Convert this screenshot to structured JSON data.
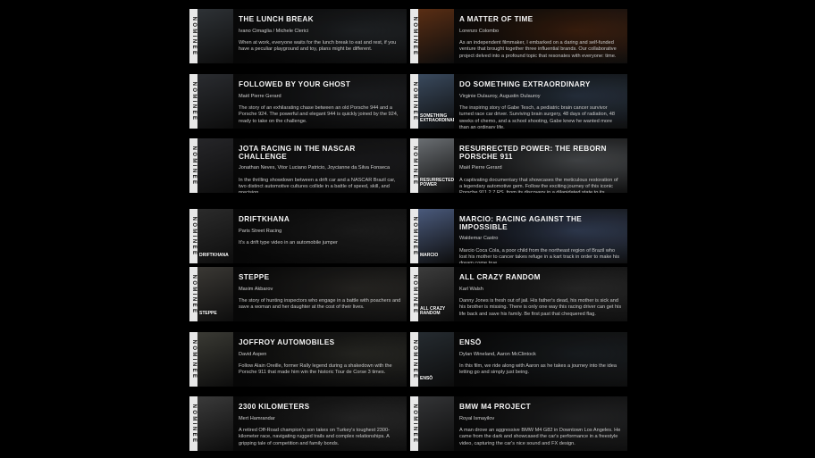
{
  "nominee_label": "NOMINEE",
  "colors": {
    "page_bg": "#000000",
    "nominee_strip": "#e8e8e8",
    "title": "#f4f4f4",
    "text": "#c8c8c8"
  },
  "films": [
    {
      "title": "THE LUNCH BREAK",
      "credits": "Ivano Cimaglia / Michele Clerici",
      "description": "When at work, everyone waits for the lunch break to eat and rest, if you have a peculiar playground and toy, plans might be different.",
      "poster_text": "",
      "tone": "#2e3236"
    },
    {
      "title": "A MATTER OF TIME",
      "credits": "Lorenzo Colombo",
      "description": "As an independent filmmaker, I embarked on a daring and self-funded venture that brought together three influential brands. Our collaborative project delved into a profound topic that resonates with everyone: time.",
      "poster_text": "",
      "tone": "#5a2e14"
    },
    {
      "title": "FOLLOWED BY YOUR GHOST",
      "credits": "Maël Pierre Gerard",
      "description": "The story of an exhilarating chase between an old Porsche 944 and a Porsche 924. The powerful and elegant 944 is quickly joined by the 924, ready to take on the challenge.",
      "poster_text": "",
      "tone": "#2a2c30"
    },
    {
      "title": "DO SOMETHING EXTRAORDINARY",
      "credits": "Virginie Dulauroy, Augustin Dulauroy",
      "description": "The inspiring story of Gabe Tesch, a pediatric brain cancer survivor turned race car driver. Surviving brain surgery, 48 days of radiation, 48 weeks of chemo, and a school shooting, Gabe knew he wanted more than an ordinary life.",
      "poster_text": "SOMETHING EXTRAORDINARY",
      "tone": "#3a4a5e"
    },
    {
      "title": "JOTA RACING IN THE NASCAR CHALLENGE",
      "credits": "Jonathan Neves, Vitor Luciano Patricio, Joycianne da Silva Fonseca",
      "description": "In the thrilling showdown between a drift car and a NASCAR Brazil car, two distinct automotive cultures collide in a battle of speed, skill, and precision.",
      "poster_text": "",
      "tone": "#262629"
    },
    {
      "title": "RESURRECTED POWER: THE REBORN PORSCHE 911",
      "credits": "Maël Pierre Gerard",
      "description": "A captivating documentary that showcases the meticulous restoration of a legendary automotive gem. Follow the exciting journey of this iconic Porsche 911 2.7 RS, from its discovery in a dilapidated state to its transformation into a true mechanical work of art.",
      "poster_text": "RESURRECTED POWER",
      "tone": "#6a6e72"
    },
    {
      "title": "DRIFTKHANA",
      "credits": "Paris Street Racing",
      "description": "It's a drift type video in an automobile jumper",
      "poster_text": "DRIFTKHANA",
      "tone": "#2b2b2b"
    },
    {
      "title": "MARCIO: RACING AGAINST THE IMPOSSIBLE",
      "credits": "Waldemar Castro",
      "description": "Marcio Coca Cola, a poor child from the northeast region of Brazil who lost his mother to cancer takes refuge in a kart track in order to make his dream come true.",
      "poster_text": "MARCIO",
      "tone": "#4a5a7c"
    },
    {
      "title": "STEPPE",
      "credits": "Maxim Akbarov",
      "description": "The story of hunting inspectors who engage in a battle with poachers and save a woman and her daughter at the cost of their lives.",
      "poster_text": "STEPPE",
      "tone": "#3a3834"
    },
    {
      "title": "ALL CRAZY RANDOM",
      "credits": "Karl Walsh",
      "description": "Danny Jones is fresh out of jail. His father's dead, his mother is sick and his brother is missing. There is only one way this racing driver can get his life back and save his family. Be first past that chequered flag.",
      "poster_text": "ALL CRAZY RANDOM",
      "tone": "#3c3c3c"
    },
    {
      "title": "JOFFROY AUTOMOBILES",
      "credits": "David Aspen",
      "description": "Follow Alain Oreille, former Rally legend during a shakedown with the Porsche 911 that made him win the historic Tour de Corse 3 times.",
      "poster_text": "",
      "tone": "#3a3a34"
    },
    {
      "title": "ENSŌ",
      "credits": "Dylan Wineland, Aaron McClintock",
      "description": "In this film, we ride along with Aaron as he takes a journey into the idea letting go and simply just being.",
      "poster_text": "ENSŌ",
      "tone": "#252b30"
    },
    {
      "title": "2300 KILOMETERS",
      "credits": "Mert Hamrandar",
      "description": "A retired Off-Road champion's son takes on Turkey's toughest 2300-kilometer race, navigating rugged trails and complex relationships. A gripping tale of competition and family bonds.",
      "poster_text": "",
      "tone": "#3a3a3a"
    },
    {
      "title": "BMW M4 PROJECT",
      "credits": "Royal Ismayilov",
      "description": "A man drove an aggressive BMW M4 G82 in Downtown Los Angeles. He came from the dark and showcased the car's performance in a freestyle video, capturing the car's nice sound and FX design.",
      "poster_text": "",
      "tone": "#333436"
    }
  ]
}
